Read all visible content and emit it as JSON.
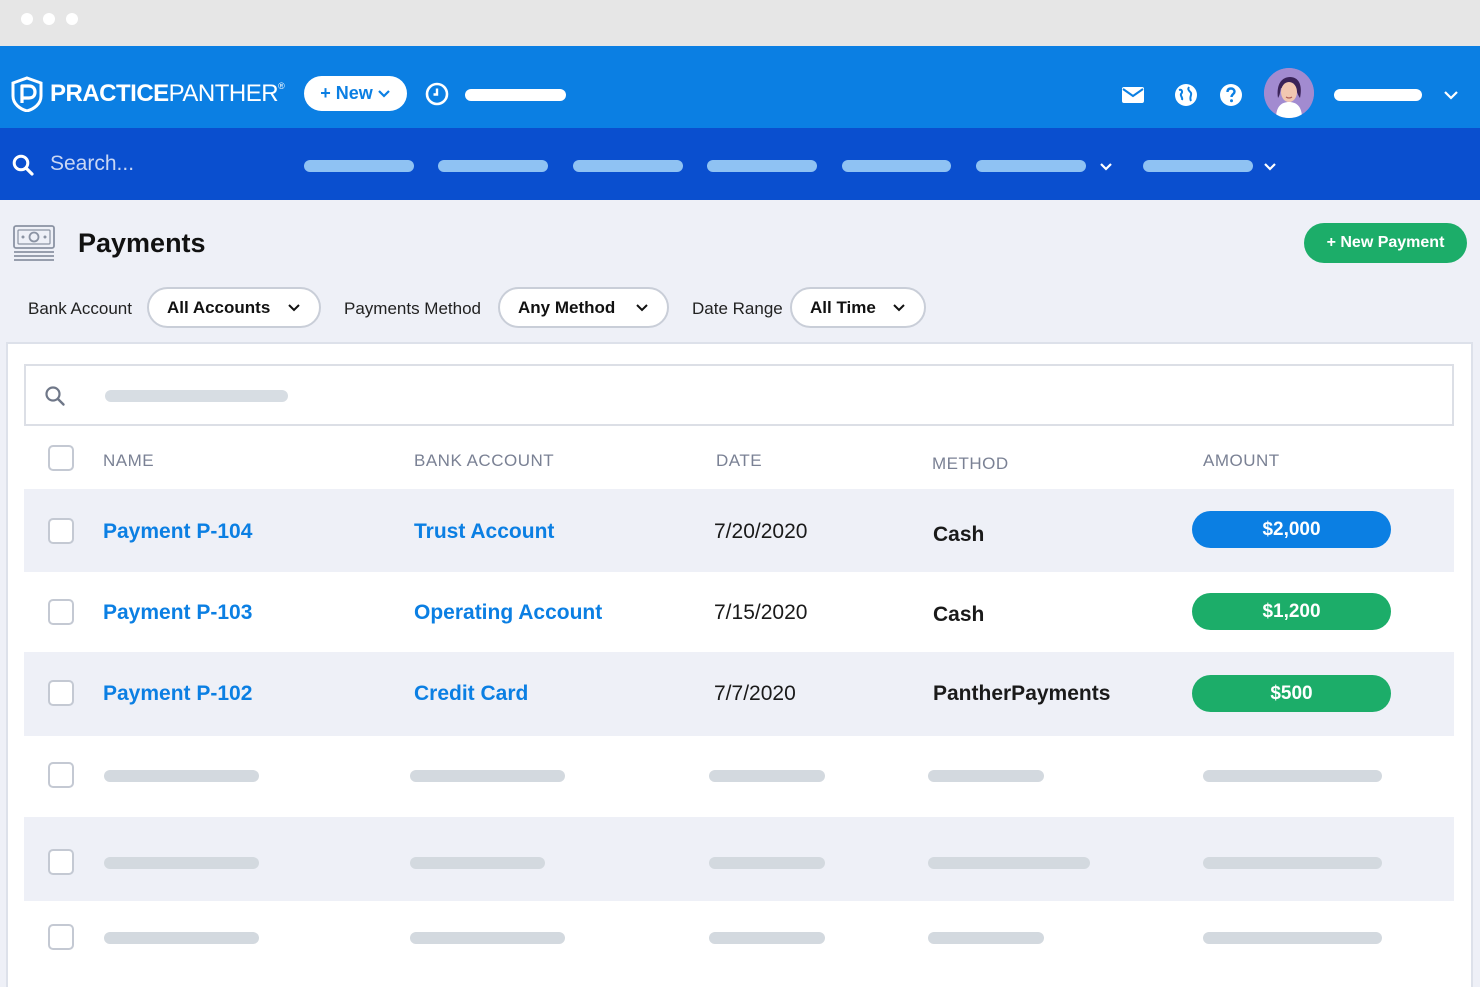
{
  "app": {
    "brand_bold": "PRACTICE",
    "brand_light": "PANTHER",
    "brand_mark": "®",
    "new_label": "+ New",
    "search_placeholder": "Search...",
    "colors": {
      "primary": "#0b7fe3",
      "nav": "#0a4fcf",
      "green": "#1cad69"
    }
  },
  "icons": [
    "panther-logo-icon",
    "chevron-down-icon",
    "clock-icon",
    "mail-icon",
    "globe-icon",
    "help-icon",
    "search-icon",
    "money-icon"
  ],
  "page": {
    "title": "Payments",
    "new_button": "+ New Payment"
  },
  "filters": {
    "bank_account": {
      "label": "Bank Account",
      "value": "All Accounts"
    },
    "method": {
      "label": "Payments Method",
      "value": "Any Method"
    },
    "date_range": {
      "label": "Date Range",
      "value": "All Time"
    }
  },
  "table": {
    "columns": [
      "NAME",
      "BANK ACCOUNT",
      "DATE",
      "METHOD",
      "AMOUNT"
    ],
    "rows": [
      {
        "name": "Payment P-104",
        "bank_account": "Trust Account",
        "date": "7/20/2020",
        "method": "Cash",
        "amount": "$2,000",
        "amount_color": "#0b7fe3"
      },
      {
        "name": "Payment P-103",
        "bank_account": "Operating Account",
        "date": "7/15/2020",
        "method": "Cash",
        "amount": "$1,200",
        "amount_color": "#1cad69"
      },
      {
        "name": "Payment P-102",
        "bank_account": "Credit Card",
        "date": "7/7/2020",
        "method": "PantherPayments",
        "amount": "$500",
        "amount_color": "#1cad69"
      }
    ]
  }
}
